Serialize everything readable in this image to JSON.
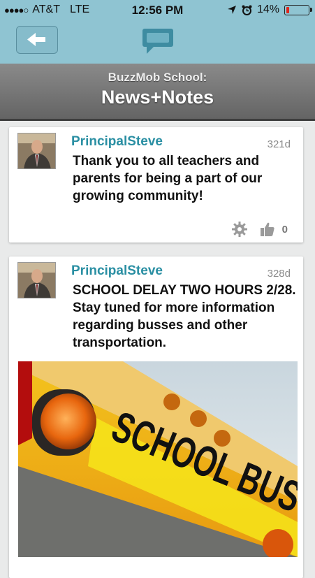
{
  "status_bar": {
    "carrier": "AT&T",
    "network": "LTE",
    "time": "12:56 PM",
    "battery": "14%",
    "battery_level": 0.14
  },
  "nav": {
    "back_icon": "back-arrow-icon",
    "chat_icon": "chat-bubble-icon"
  },
  "header": {
    "subtitle": "BuzzMob School:",
    "title": "News+Notes"
  },
  "posts": [
    {
      "author": "PrincipalSteve",
      "age": "321d",
      "message": "Thank you to all teachers and parents for being a part of our growing community!",
      "likes": "0"
    },
    {
      "author": "PrincipalSteve",
      "age": "328d",
      "message": "SCHOOL DELAY TWO HOURS 2/28. Stay tuned for more information regarding busses and other transportation.",
      "photo_text": "SCHOOL BUS"
    }
  ],
  "colors": {
    "nav_bg": "#8fc4d2",
    "author": "#2a8fa3",
    "battery_low": "#e0251b"
  }
}
